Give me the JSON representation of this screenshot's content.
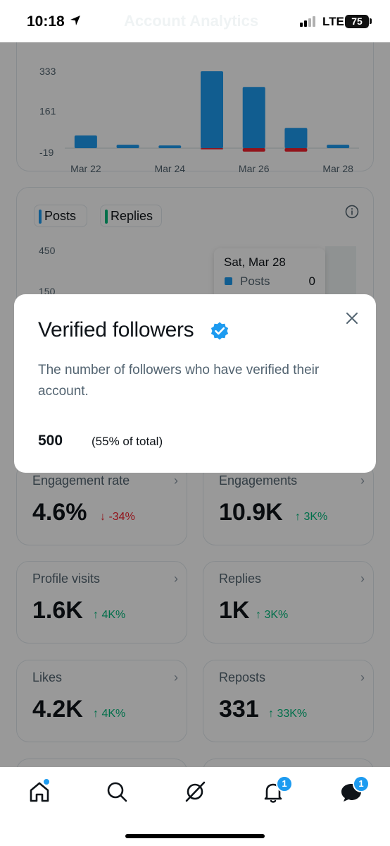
{
  "status_bar": {
    "time": "10:18",
    "network": "LTE",
    "battery": "75",
    "icons": [
      "location-arrow-icon",
      "signal-icon"
    ]
  },
  "header": {
    "title": "Account Analytics"
  },
  "impressions_chart": {
    "y_ticks": [
      "333",
      "161",
      "-19"
    ],
    "x_ticks": [
      "Mar 22",
      "Mar 24",
      "Mar 26",
      "Mar 28"
    ]
  },
  "chart_data": {
    "type": "bar",
    "categories": [
      "Mar 22",
      "Mar 23",
      "Mar 24",
      "Mar 25",
      "Mar 26",
      "Mar 27",
      "Mar 28"
    ],
    "series": [
      {
        "values": [
          55,
          15,
          12,
          333,
          265,
          88,
          15
        ]
      },
      {
        "values": [
          0,
          0,
          0,
          -5,
          -15,
          -15,
          0
        ]
      }
    ],
    "ylim": [
      -19,
      333
    ]
  },
  "engagement_chart": {
    "legend": [
      {
        "label": "Posts",
        "color": "#1d9bf0"
      },
      {
        "label": "Replies",
        "color": "#00ba7c"
      }
    ],
    "y_ticks": [
      "450",
      "150"
    ],
    "tooltip": {
      "title": "Sat, Mar 28",
      "row_label": "Posts",
      "row_value": "0"
    }
  },
  "modal": {
    "title": "Verified followers",
    "description": "The number of followers who have verified their account.",
    "count": "500",
    "percent": "(55% of total)",
    "icons": [
      "verified-badge-icon",
      "close-icon"
    ]
  },
  "metrics": [
    {
      "label": "Engagement rate",
      "value": "4.6%",
      "delta": "↓ -34%",
      "direction": "down"
    },
    {
      "label": "Engagements",
      "value": "10.9K",
      "delta": "↑ 3K%",
      "direction": "up"
    },
    {
      "label": "Profile visits",
      "value": "1.6K",
      "delta": "↑ 4K%",
      "direction": "up"
    },
    {
      "label": "Replies",
      "value": "1K",
      "delta": "↑ 3K%",
      "direction": "up"
    },
    {
      "label": "Likes",
      "value": "4.2K",
      "delta": "↑ 4K%",
      "direction": "up"
    },
    {
      "label": "Reposts",
      "value": "331",
      "delta": "↑ 33K%",
      "direction": "up"
    }
  ],
  "tab_bar": {
    "tabs": [
      "home-icon",
      "search-icon",
      "grok-icon",
      "notifications-icon",
      "messages-icon"
    ],
    "notifications_badge": "1",
    "messages_badge": "1"
  },
  "colors": {
    "accent": "#1d9bf0",
    "up": "#00ba7c",
    "down": "#f4212e"
  }
}
